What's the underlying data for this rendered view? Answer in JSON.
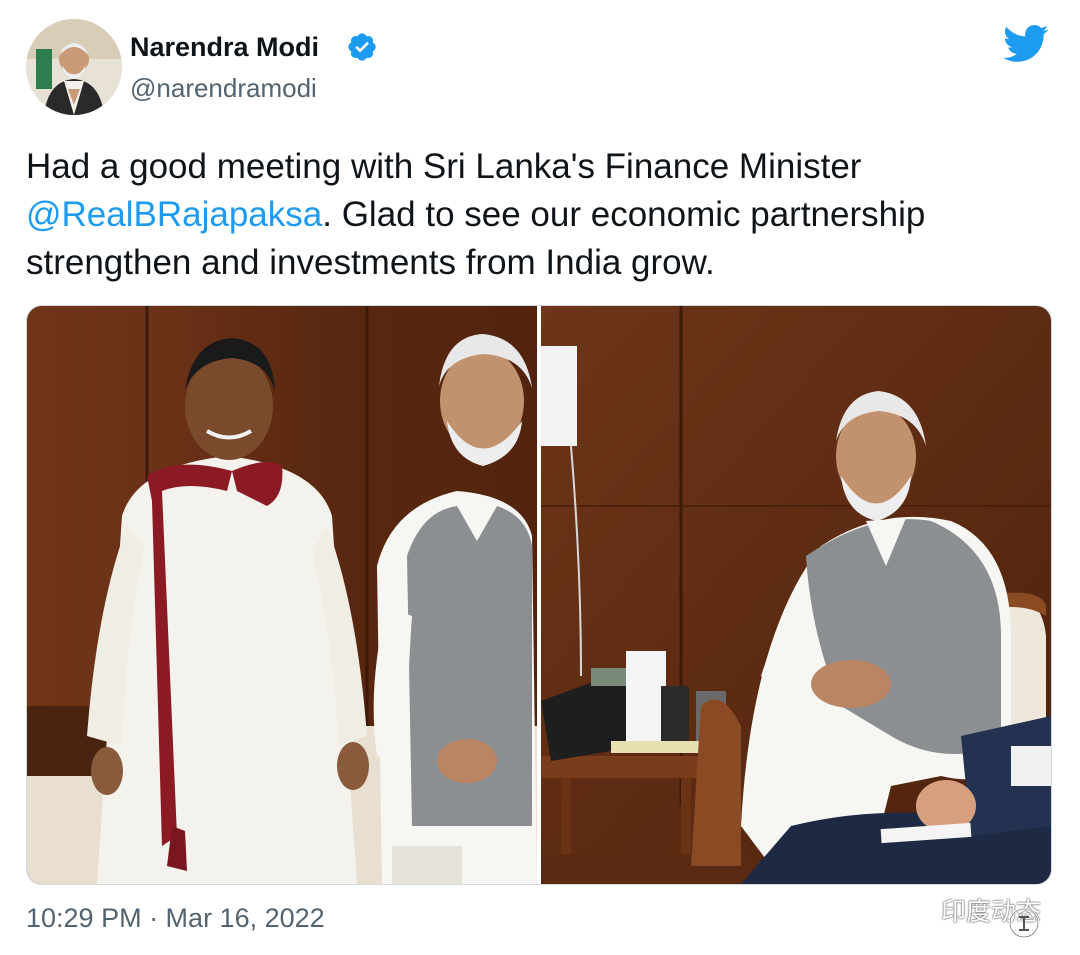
{
  "author": {
    "display_name": "Narendra Modi",
    "handle": "@narendramodi",
    "avatar_icon": "profile-avatar",
    "verified_icon": "verified-badge-icon"
  },
  "platform_icon": "twitter-bird-icon",
  "tweet": {
    "text_before": "Had a good meeting with Sri Lanka's Finance Minister ",
    "mention": "@RealBRajapaksa",
    "text_after": ". Glad to see our economic partnership strengthen and investments from India grow."
  },
  "media": {
    "photo_count": 2,
    "photos": [
      "meeting-photo-standing",
      "meeting-photo-seated"
    ]
  },
  "timestamp": "10:29 PM · Mar 16, 2022",
  "watermark": {
    "text": "印度动态",
    "icon": "wechat-icon"
  },
  "colors": {
    "link": "#1d9bf0",
    "verified": "#1d9bf0",
    "secondary_text": "#536471",
    "primary_text": "#0f1419"
  }
}
